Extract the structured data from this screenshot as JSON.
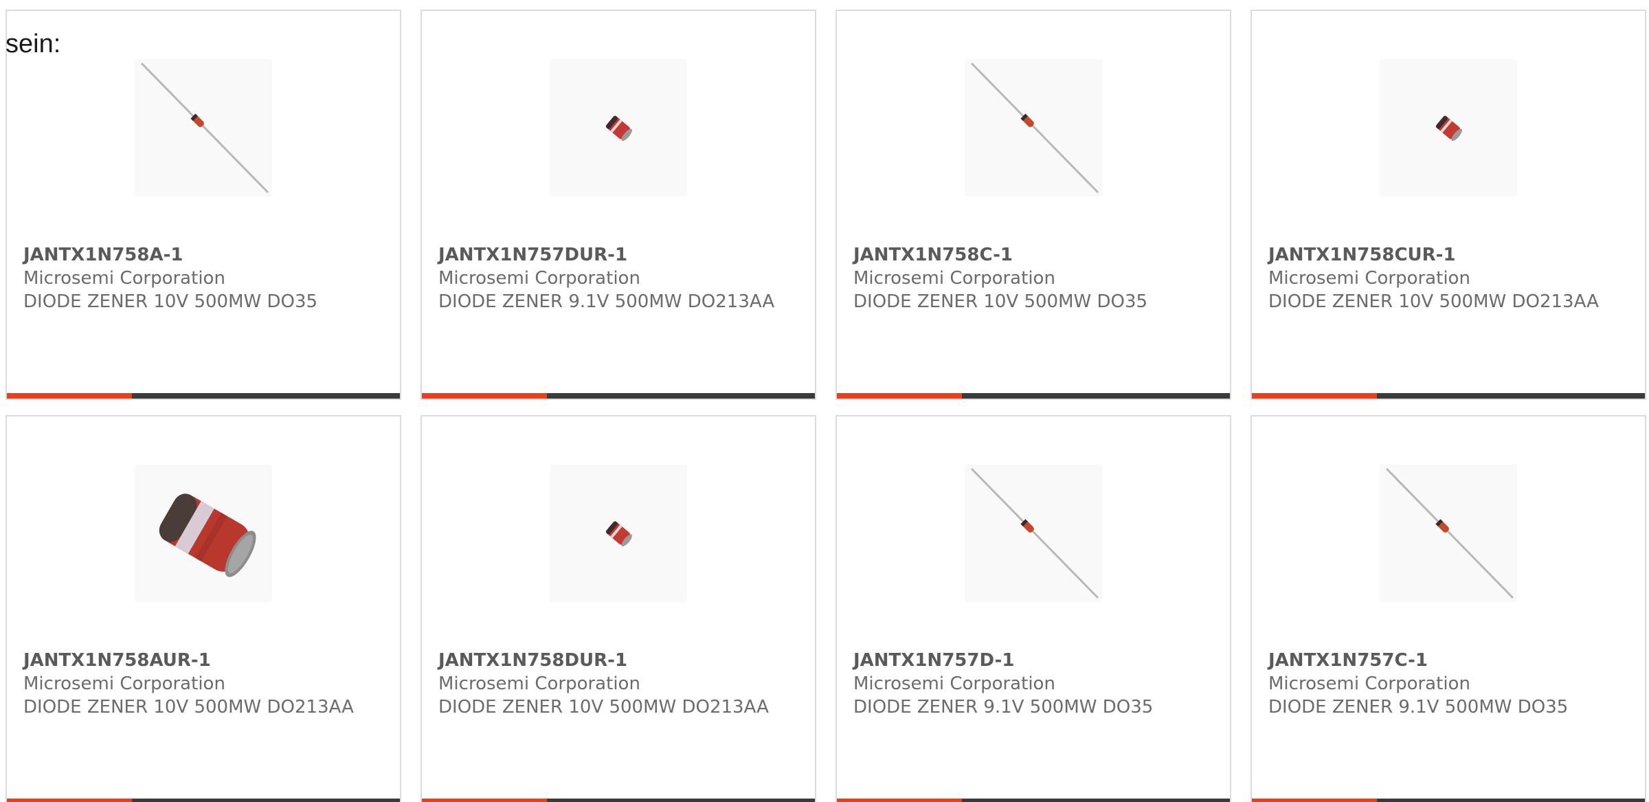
{
  "lead_text": "sein:",
  "accent_color": "#e6401c",
  "bar_color": "#3a3a3a",
  "products": [
    {
      "part_number": "JANTX1N758A-1",
      "manufacturer": "Microsemi Corporation",
      "description": "DIODE ZENER 10V 500MW DO35",
      "image": "axial-diode-icon"
    },
    {
      "part_number": "JANTX1N757DUR-1",
      "manufacturer": "Microsemi Corporation",
      "description": "DIODE ZENER 9.1V 500MW DO213AA",
      "image": "melf-diode-small-icon"
    },
    {
      "part_number": "JANTX1N758C-1",
      "manufacturer": "Microsemi Corporation",
      "description": "DIODE ZENER 10V 500MW DO35",
      "image": "axial-diode-icon"
    },
    {
      "part_number": "JANTX1N758CUR-1",
      "manufacturer": "Microsemi Corporation",
      "description": "DIODE ZENER 10V 500MW DO213AA",
      "image": "melf-diode-small-icon"
    },
    {
      "part_number": "JANTX1N758AUR-1",
      "manufacturer": "Microsemi Corporation",
      "description": "DIODE ZENER 10V 500MW DO213AA",
      "image": "melf-diode-large-icon"
    },
    {
      "part_number": "JANTX1N758DUR-1",
      "manufacturer": "Microsemi Corporation",
      "description": "DIODE ZENER 10V 500MW DO213AA",
      "image": "melf-diode-small-icon"
    },
    {
      "part_number": "JANTX1N757D-1",
      "manufacturer": "Microsemi Corporation",
      "description": "DIODE ZENER 9.1V 500MW DO35",
      "image": "axial-diode-icon"
    },
    {
      "part_number": "JANTX1N757C-1",
      "manufacturer": "Microsemi Corporation",
      "description": "DIODE ZENER 9.1V 500MW DO35",
      "image": "axial-diode-icon"
    }
  ]
}
